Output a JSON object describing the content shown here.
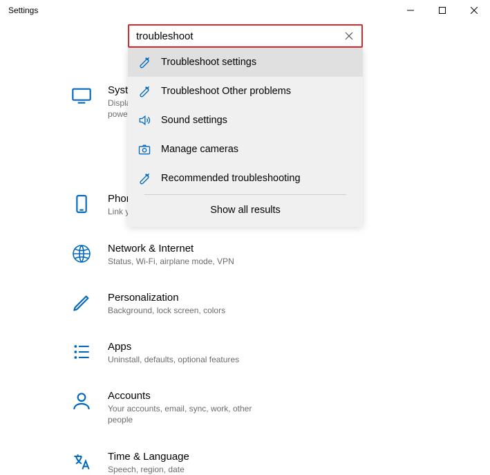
{
  "window": {
    "title": "Settings"
  },
  "search": {
    "value": "troubleshoot",
    "show_all_label": "Show all results",
    "results": [
      {
        "icon": "wrench",
        "label": "Troubleshoot settings"
      },
      {
        "icon": "wrench",
        "label": "Troubleshoot Other problems"
      },
      {
        "icon": "speaker",
        "label": "Sound settings"
      },
      {
        "icon": "camera",
        "label": "Manage cameras"
      },
      {
        "icon": "wrench",
        "label": "Recommended troubleshooting"
      }
    ]
  },
  "categories": [
    {
      "icon": "monitor",
      "title": "System",
      "desc": "Display, sound, notifications, mouse power"
    },
    {
      "icon": "empty",
      "title": "",
      "desc": ""
    },
    {
      "icon": "phone",
      "title": "Phone",
      "desc": "Link your phone"
    },
    {
      "icon": "globe",
      "title": "Network & Internet",
      "desc": "Status, Wi-Fi, airplane mode, VPN"
    },
    {
      "icon": "pen",
      "title": "Personalization",
      "desc": "Background, lock screen, colors"
    },
    {
      "icon": "apps",
      "title": "Apps",
      "desc": "Uninstall, defaults, optional features"
    },
    {
      "icon": "person",
      "title": "Accounts",
      "desc": "Your accounts, email, sync, work, other people"
    },
    {
      "icon": "language",
      "title": "Time & Language",
      "desc": "Speech, region, date"
    }
  ]
}
